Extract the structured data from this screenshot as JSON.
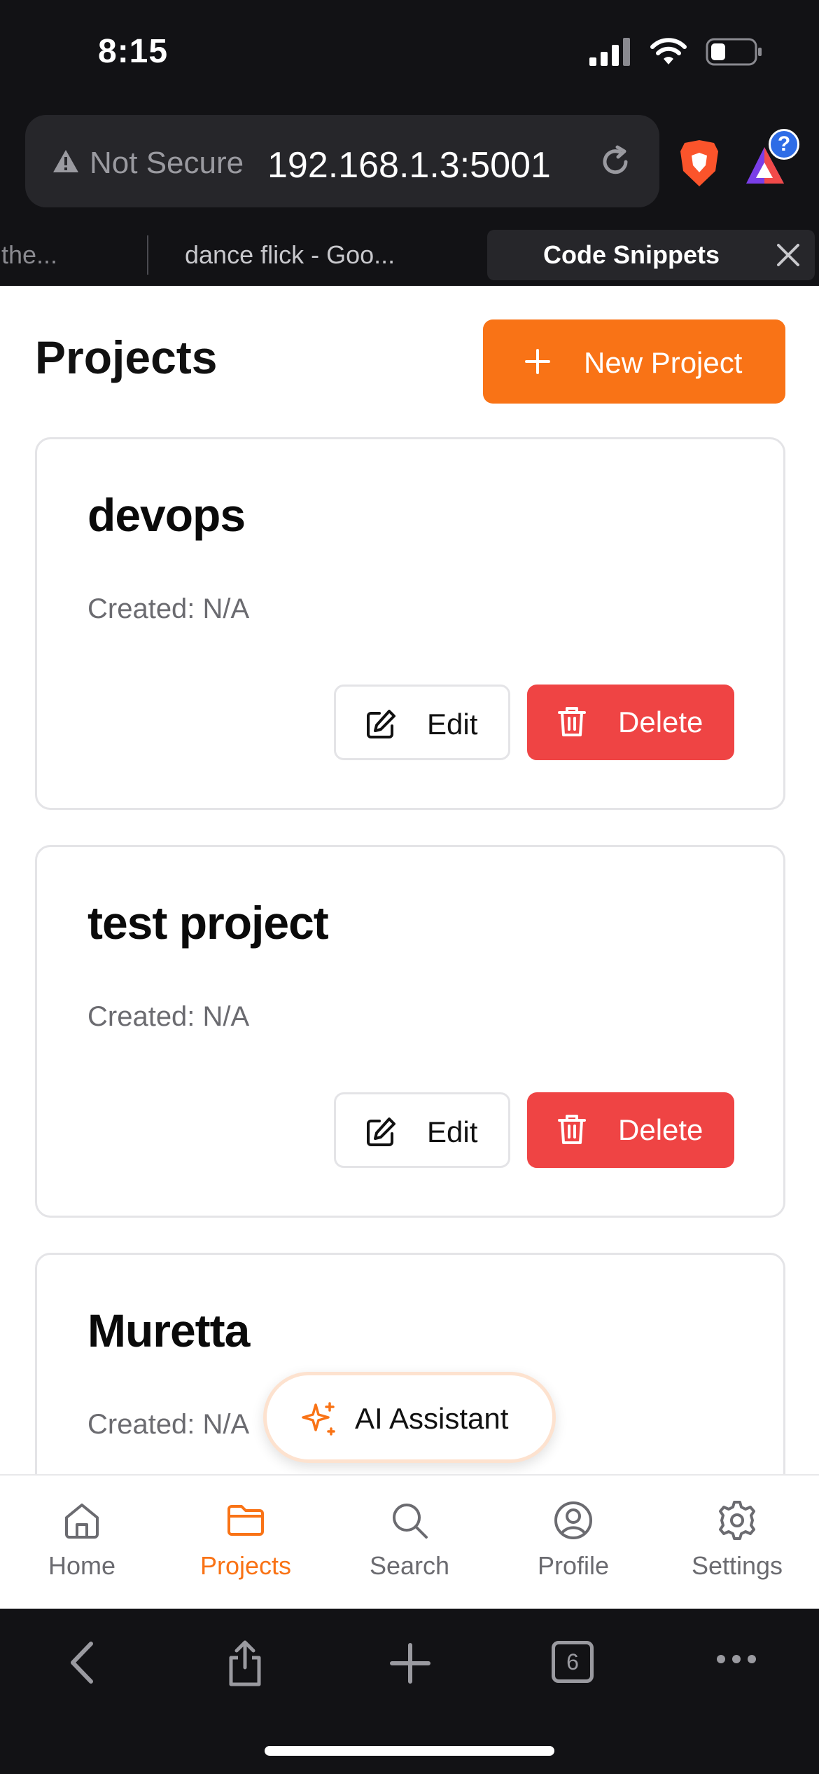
{
  "status_bar": {
    "time": "8:15"
  },
  "browser": {
    "not_secure_label": "Not Secure",
    "url": "192.168.1.3:5001",
    "rewards_badge": "?",
    "tabs": [
      {
        "label": "f the..."
      },
      {
        "label": "dance flick - Goo..."
      },
      {
        "label": "Code Snippets"
      }
    ],
    "tab_count": "6"
  },
  "page": {
    "title": "Projects",
    "new_project_label": "New Project",
    "projects": [
      {
        "name": "devops",
        "created": "Created: N/A",
        "edit_label": "Edit",
        "delete_label": "Delete"
      },
      {
        "name": "test project",
        "created": "Created: N/A",
        "edit_label": "Edit",
        "delete_label": "Delete"
      },
      {
        "name": "Muretta",
        "created": "Created: N/A"
      }
    ],
    "ai_assistant_label": "AI Assistant"
  },
  "bottom_nav": {
    "items": [
      {
        "label": "Home",
        "icon": "home-icon"
      },
      {
        "label": "Projects",
        "icon": "folder-icon",
        "active": true
      },
      {
        "label": "Search",
        "icon": "search-icon"
      },
      {
        "label": "Profile",
        "icon": "user-circle-icon"
      },
      {
        "label": "Settings",
        "icon": "gear-icon"
      }
    ]
  },
  "colors": {
    "accent": "#f97316",
    "danger": "#ef4444",
    "chrome": "#121215"
  }
}
